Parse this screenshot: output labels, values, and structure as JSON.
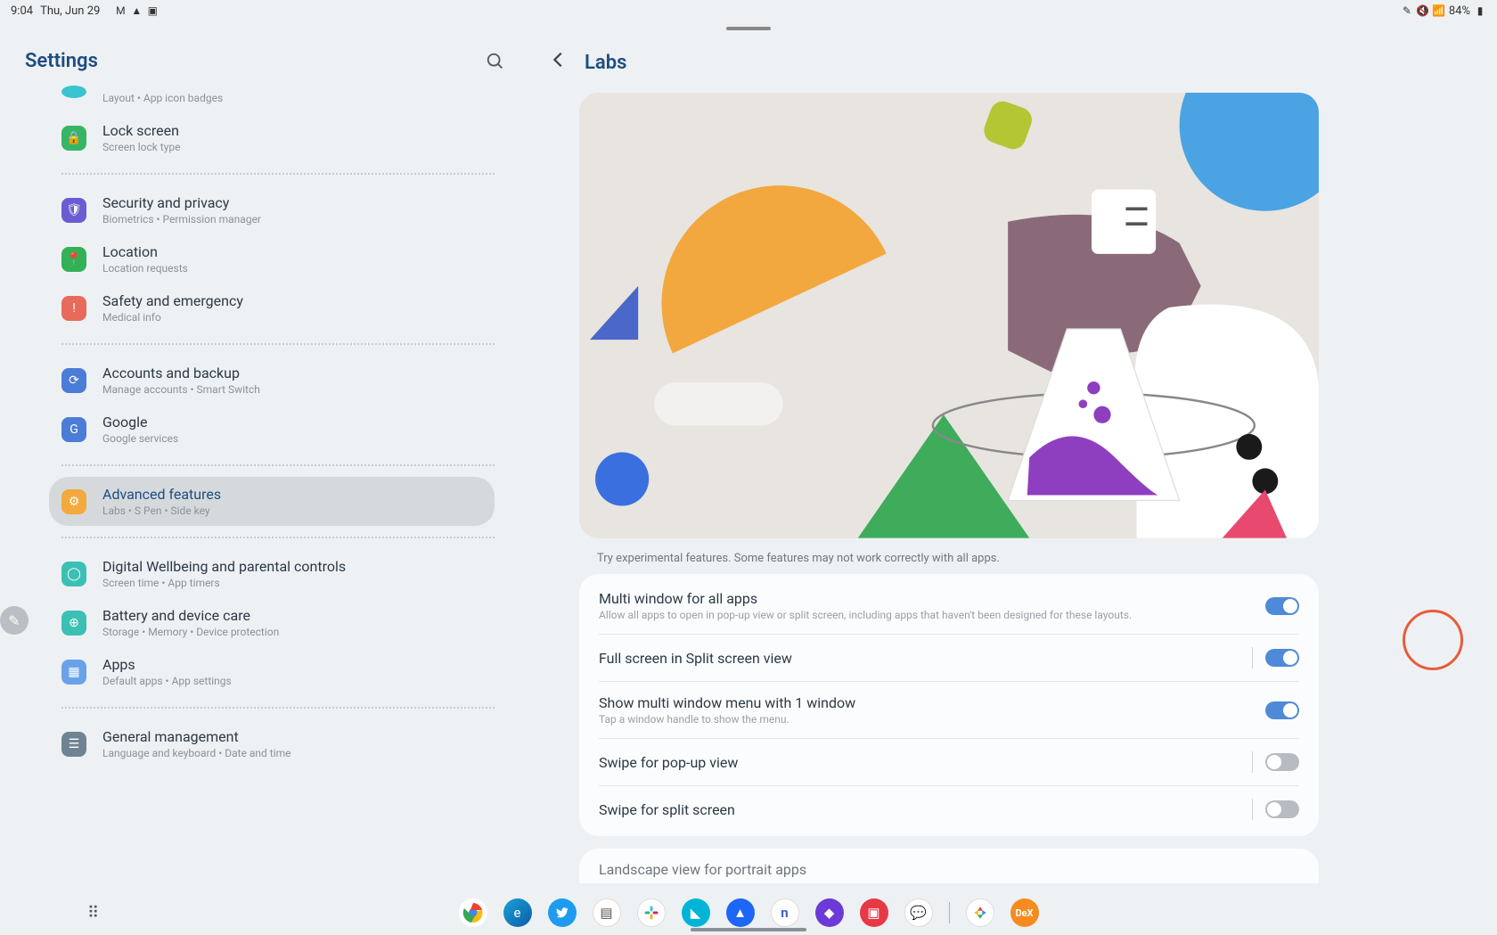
{
  "status": {
    "time": "9:04",
    "date": "Thu, Jun 29",
    "battery": "84%"
  },
  "left": {
    "title": "Settings",
    "items": [
      {
        "icon": "ic-blue-teal",
        "title": "",
        "subtitle": "Layout  •  App icon badges",
        "partial": true
      },
      {
        "icon": "ic-green",
        "title": "Lock screen",
        "subtitle": "Screen lock type"
      },
      {
        "divider": true
      },
      {
        "icon": "ic-purple",
        "title": "Security and privacy",
        "subtitle": "Biometrics  •  Permission manager"
      },
      {
        "icon": "ic-green2",
        "title": "Location",
        "subtitle": "Location requests"
      },
      {
        "icon": "ic-red",
        "title": "Safety and emergency",
        "subtitle": "Medical info"
      },
      {
        "divider": true
      },
      {
        "icon": "ic-blue",
        "title": "Accounts and backup",
        "subtitle": "Manage accounts  •  Smart Switch"
      },
      {
        "icon": "ic-gblue",
        "title": "Google",
        "subtitle": "Google services"
      },
      {
        "divider": true
      },
      {
        "icon": "ic-orange",
        "title": "Advanced features",
        "subtitle": "Labs  •  S Pen  •  Side key",
        "selected": true
      },
      {
        "divider": true
      },
      {
        "icon": "ic-teal",
        "title": "Digital Wellbeing and parental controls",
        "subtitle": "Screen time  •  App timers"
      },
      {
        "icon": "ic-teal",
        "title": "Battery and device care",
        "subtitle": "Storage  •  Memory  •  Device protection"
      },
      {
        "icon": "ic-bluel",
        "title": "Apps",
        "subtitle": "Default apps  •  App settings"
      },
      {
        "divider": true
      },
      {
        "icon": "ic-grey",
        "title": "General management",
        "subtitle": "Language and keyboard  •  Date and time"
      }
    ]
  },
  "right": {
    "title": "Labs",
    "description": "Try experimental features. Some features may not work correctly with all apps.",
    "rows": [
      {
        "title": "Multi window for all apps",
        "subtitle": "Allow all apps to open in pop-up view or split screen, including apps that haven't been designed for these layouts.",
        "on": true,
        "arrow": false
      },
      {
        "title": "Full screen in Split screen view",
        "subtitle": "",
        "on": true,
        "arrow": true
      },
      {
        "title": "Show multi window menu with 1 window",
        "subtitle": "Tap a window handle to show the menu.",
        "on": true,
        "arrow": false
      },
      {
        "title": "Swipe for pop-up view",
        "subtitle": "",
        "on": false,
        "arrow": true
      },
      {
        "title": "Swipe for split screen",
        "subtitle": "",
        "on": false,
        "arrow": true
      }
    ],
    "extra_row": {
      "title": "Landscape view for portrait apps"
    }
  },
  "colors": {
    "accent": "#4f8ad8",
    "highlight": "#e85c39"
  }
}
